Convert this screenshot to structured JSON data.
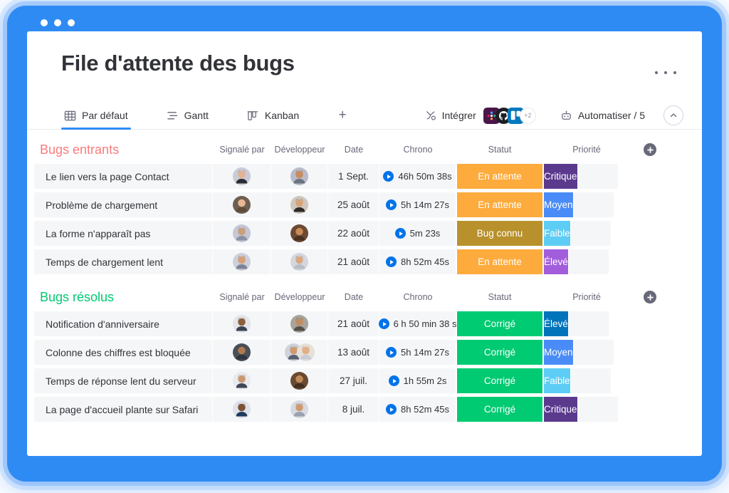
{
  "window": {
    "traffic_lights": [
      "close",
      "minimize",
      "maximize"
    ]
  },
  "header": {
    "title": "File d'attente des bugs",
    "menu_icon": "ellipsis-icon"
  },
  "tabs": [
    {
      "label": "Par défaut",
      "icon": "table-grid-icon",
      "active": true
    },
    {
      "label": "Gantt",
      "icon": "gantt-icon",
      "active": false
    },
    {
      "label": "Kanban",
      "icon": "kanban-icon",
      "active": false
    }
  ],
  "add_view_label": "+",
  "toolbar": {
    "integrate_label": "Intégrer",
    "integrate_icon": "integrate-icon",
    "integrations": [
      {
        "name": "slack",
        "color": "#4a154b"
      },
      {
        "name": "github",
        "color": "#1b1f23"
      },
      {
        "name": "trello",
        "color": "#0079bf"
      }
    ],
    "integrations_overflow": "+2",
    "automate_label": "Automatiser / 5",
    "automate_icon": "robot-icon",
    "collapse_icon": "chevron-up-icon"
  },
  "columns": [
    "Signalé par",
    "Développeur",
    "Date",
    "Chrono",
    "Statut",
    "Priorité"
  ],
  "add_column_label": "+",
  "colors": {
    "accent_blue": "#2f8bf4",
    "group_red": "#fb7b7b",
    "group_green": "#00ca72",
    "status_pending": "#fdab3d",
    "status_known_bug": "#b8912c",
    "status_fixed": "#00ca72",
    "priority_critique": "#5b3a8e",
    "priority_eleve_purple": "#a25ddc",
    "priority_eleve_blue": "#0073ba",
    "priority_moyen": "#4a8cf7",
    "priority_faible": "#5dcdf5"
  },
  "groups": [
    {
      "title": "Bugs entrants",
      "color": "#fb7b7b",
      "color_class": "red",
      "items": [
        {
          "name": "Le lien vers la page Contact",
          "reporter": {
            "icon": "avatar",
            "bg": "#c9cbd6",
            "skin": "#e3b294",
            "hair": "#3e2d22",
            "shirt": "#2b2b33"
          },
          "developers": [
            {
              "icon": "avatar",
              "bg": "#b9bcc8",
              "skin": "#c98c5e",
              "hair": "#1e1b18",
              "shirt": "#6b7280"
            }
          ],
          "date": "1 Sept.",
          "chrono": "46h 50m 38s",
          "status": {
            "label": "En attente",
            "color": "#fdab3d"
          },
          "priority": {
            "label": "Critique",
            "color": "#5b3a8e"
          }
        },
        {
          "name": "Problème de chargement",
          "reporter": {
            "icon": "avatar",
            "bg": "#6e5f52",
            "skin": "#e8b894",
            "hair": "#8a5a2b",
            "shirt": "#5e4a3a"
          },
          "developers": [
            {
              "icon": "avatar",
              "bg": "#cfc7bd",
              "skin": "#d9a277",
              "hair": "#1a1411",
              "shirt": "#2d2a28"
            }
          ],
          "date": "25 août",
          "chrono": "5h 14m 27s",
          "status": {
            "label": "En attente",
            "color": "#fdab3d"
          },
          "priority": {
            "label": "Moyen",
            "color": "#4a8cf7"
          }
        },
        {
          "name": "La forme n'apparaît pas",
          "reporter": {
            "icon": "avatar",
            "bg": "#c5c8d4",
            "skin": "#caa07a",
            "hair": "#2f3b55",
            "shirt": "#8c93a8"
          },
          "developers": [
            {
              "icon": "avatar",
              "bg": "#6c4a33",
              "skin": "#c98a58",
              "hair": "#241a13",
              "shirt": "#4a3121"
            }
          ],
          "date": "22 août",
          "chrono": "5m 23s",
          "status": {
            "label": "Bug connu",
            "color": "#b8912c"
          },
          "priority": {
            "label": "Faible",
            "color": "#5dcdf5"
          }
        },
        {
          "name": "Temps de chargement lent",
          "reporter": {
            "icon": "avatar",
            "bg": "#cdd0d9",
            "skin": "#d5a07a",
            "hair": "#2a211c",
            "shirt": "#7c8597"
          },
          "developers": [
            {
              "icon": "avatar",
              "bg": "#d5d7df",
              "skin": "#d9a780",
              "hair": "#241d18",
              "shirt": "#b9bdc8"
            }
          ],
          "date": "21 août",
          "chrono": "8h 52m 45s",
          "status": {
            "label": "En attente",
            "color": "#fdab3d"
          },
          "priority": {
            "label": "Élevé",
            "color": "#a25ddc"
          }
        }
      ]
    },
    {
      "title": "Bugs résolus",
      "color": "#00ca72",
      "color_class": "green",
      "items": [
        {
          "name": "Notification d'anniversaire",
          "reporter": {
            "icon": "avatar",
            "bg": "#e3e5ea",
            "skin": "#8a5f3c",
            "hair": "#15100c",
            "shirt": "#3b4252"
          },
          "developers": [
            {
              "icon": "avatar",
              "bg": "#a8a49c",
              "skin": "#c08c60",
              "hair": "#1c1512",
              "shirt": "#55504a"
            }
          ],
          "date": "21 août",
          "chrono": "6 h 50 min 38 s",
          "status": {
            "label": "Corrigé",
            "color": "#00ca72"
          },
          "priority": {
            "label": "Élevé",
            "color": "#0073ba"
          }
        },
        {
          "name": "Colonne des chiffres est bloquée",
          "reporter": {
            "icon": "avatar",
            "bg": "#4a4f58",
            "skin": "#b07a4e",
            "hair": "#120d0a",
            "shirt": "#2e3440"
          },
          "developers": [
            {
              "icon": "avatar",
              "bg": "#cfd2da",
              "skin": "#cf9a6f",
              "hair": "#221a14",
              "shirt": "#5a6070"
            },
            {
              "icon": "avatar",
              "bg": "#e6e1d8",
              "skin": "#e0b089",
              "hair": "#7a5330",
              "shirt": "#c7ccd6"
            }
          ],
          "date": "13 août",
          "chrono": "5h 14m 27s",
          "status": {
            "label": "Corrigé",
            "color": "#00ca72"
          },
          "priority": {
            "label": "Moyen",
            "color": "#4a8cf7"
          }
        },
        {
          "name": "Temps de réponse lent du serveur",
          "reporter": {
            "icon": "avatar",
            "bg": "#e8eaee",
            "skin": "#c99a72",
            "hair": "#3a312a",
            "shirt": "#3f4655"
          },
          "developers": [
            {
              "icon": "avatar",
              "bg": "#6b4a32",
              "skin": "#c08a58",
              "hair": "#201712",
              "shirt": "#433021"
            }
          ],
          "date": "27 juil.",
          "chrono": "1h 55m 2s",
          "status": {
            "label": "Corrigé",
            "color": "#00ca72"
          },
          "priority": {
            "label": "Faible",
            "color": "#5dcdf5"
          }
        },
        {
          "name": "La page d'accueil plante sur Safari",
          "reporter": {
            "icon": "avatar",
            "bg": "#dfe2e8",
            "skin": "#7a5236",
            "hair": "#120d09",
            "shirt": "#1f3a5f"
          },
          "developers": [
            {
              "icon": "avatar",
              "bg": "#d8dae1",
              "skin": "#cf9a70",
              "hair": "#241b15",
              "shirt": "#9aa2b1"
            }
          ],
          "date": "8 juil.",
          "chrono": "8h 52m 45s",
          "status": {
            "label": "Corrigé",
            "color": "#00ca72"
          },
          "priority": {
            "label": "Critique",
            "color": "#5b3a8e"
          }
        }
      ]
    }
  ]
}
